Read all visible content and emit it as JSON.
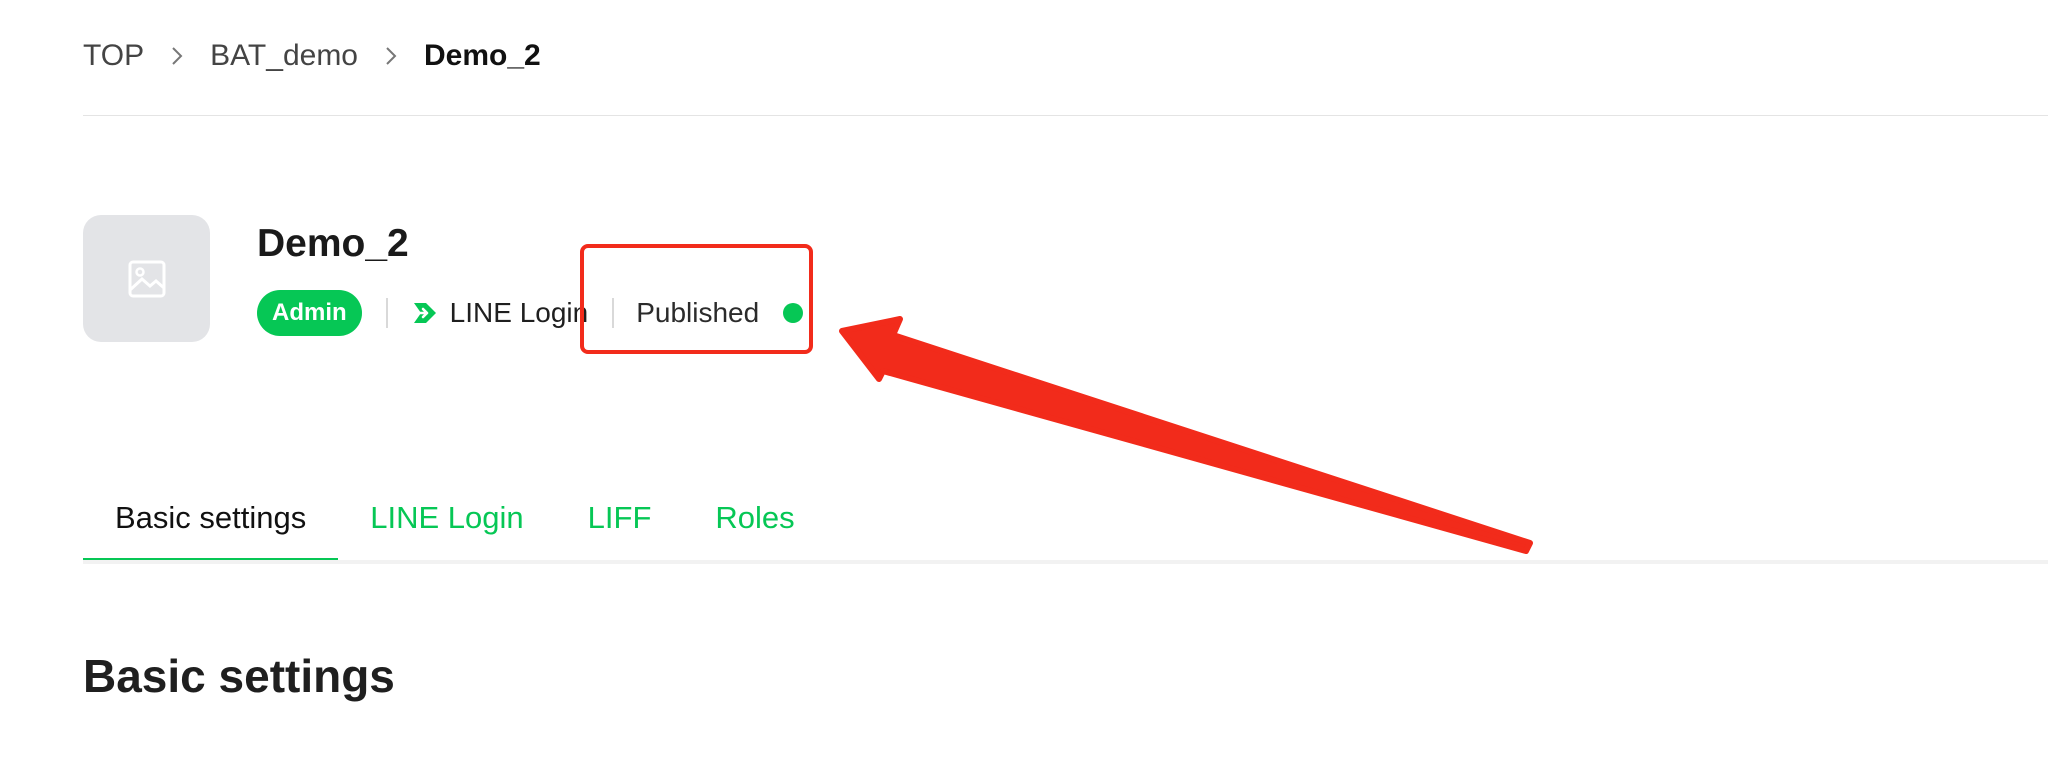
{
  "breadcrumb": {
    "items": [
      "TOP",
      "BAT_demo",
      "Demo_2"
    ]
  },
  "channel": {
    "name": "Demo_2",
    "role": "Admin",
    "product": "LINE Login",
    "status": "Published",
    "status_color": "#06c755",
    "icon": "image-placeholder-icon"
  },
  "tabs": [
    {
      "label": "Basic settings",
      "active": true
    },
    {
      "label": "LINE Login",
      "active": false
    },
    {
      "label": "LIFF",
      "active": false
    },
    {
      "label": "Roles",
      "active": false
    }
  ],
  "section": {
    "title": "Basic settings"
  },
  "colors": {
    "accent": "#06c755",
    "annotation": "#f22b1b"
  }
}
